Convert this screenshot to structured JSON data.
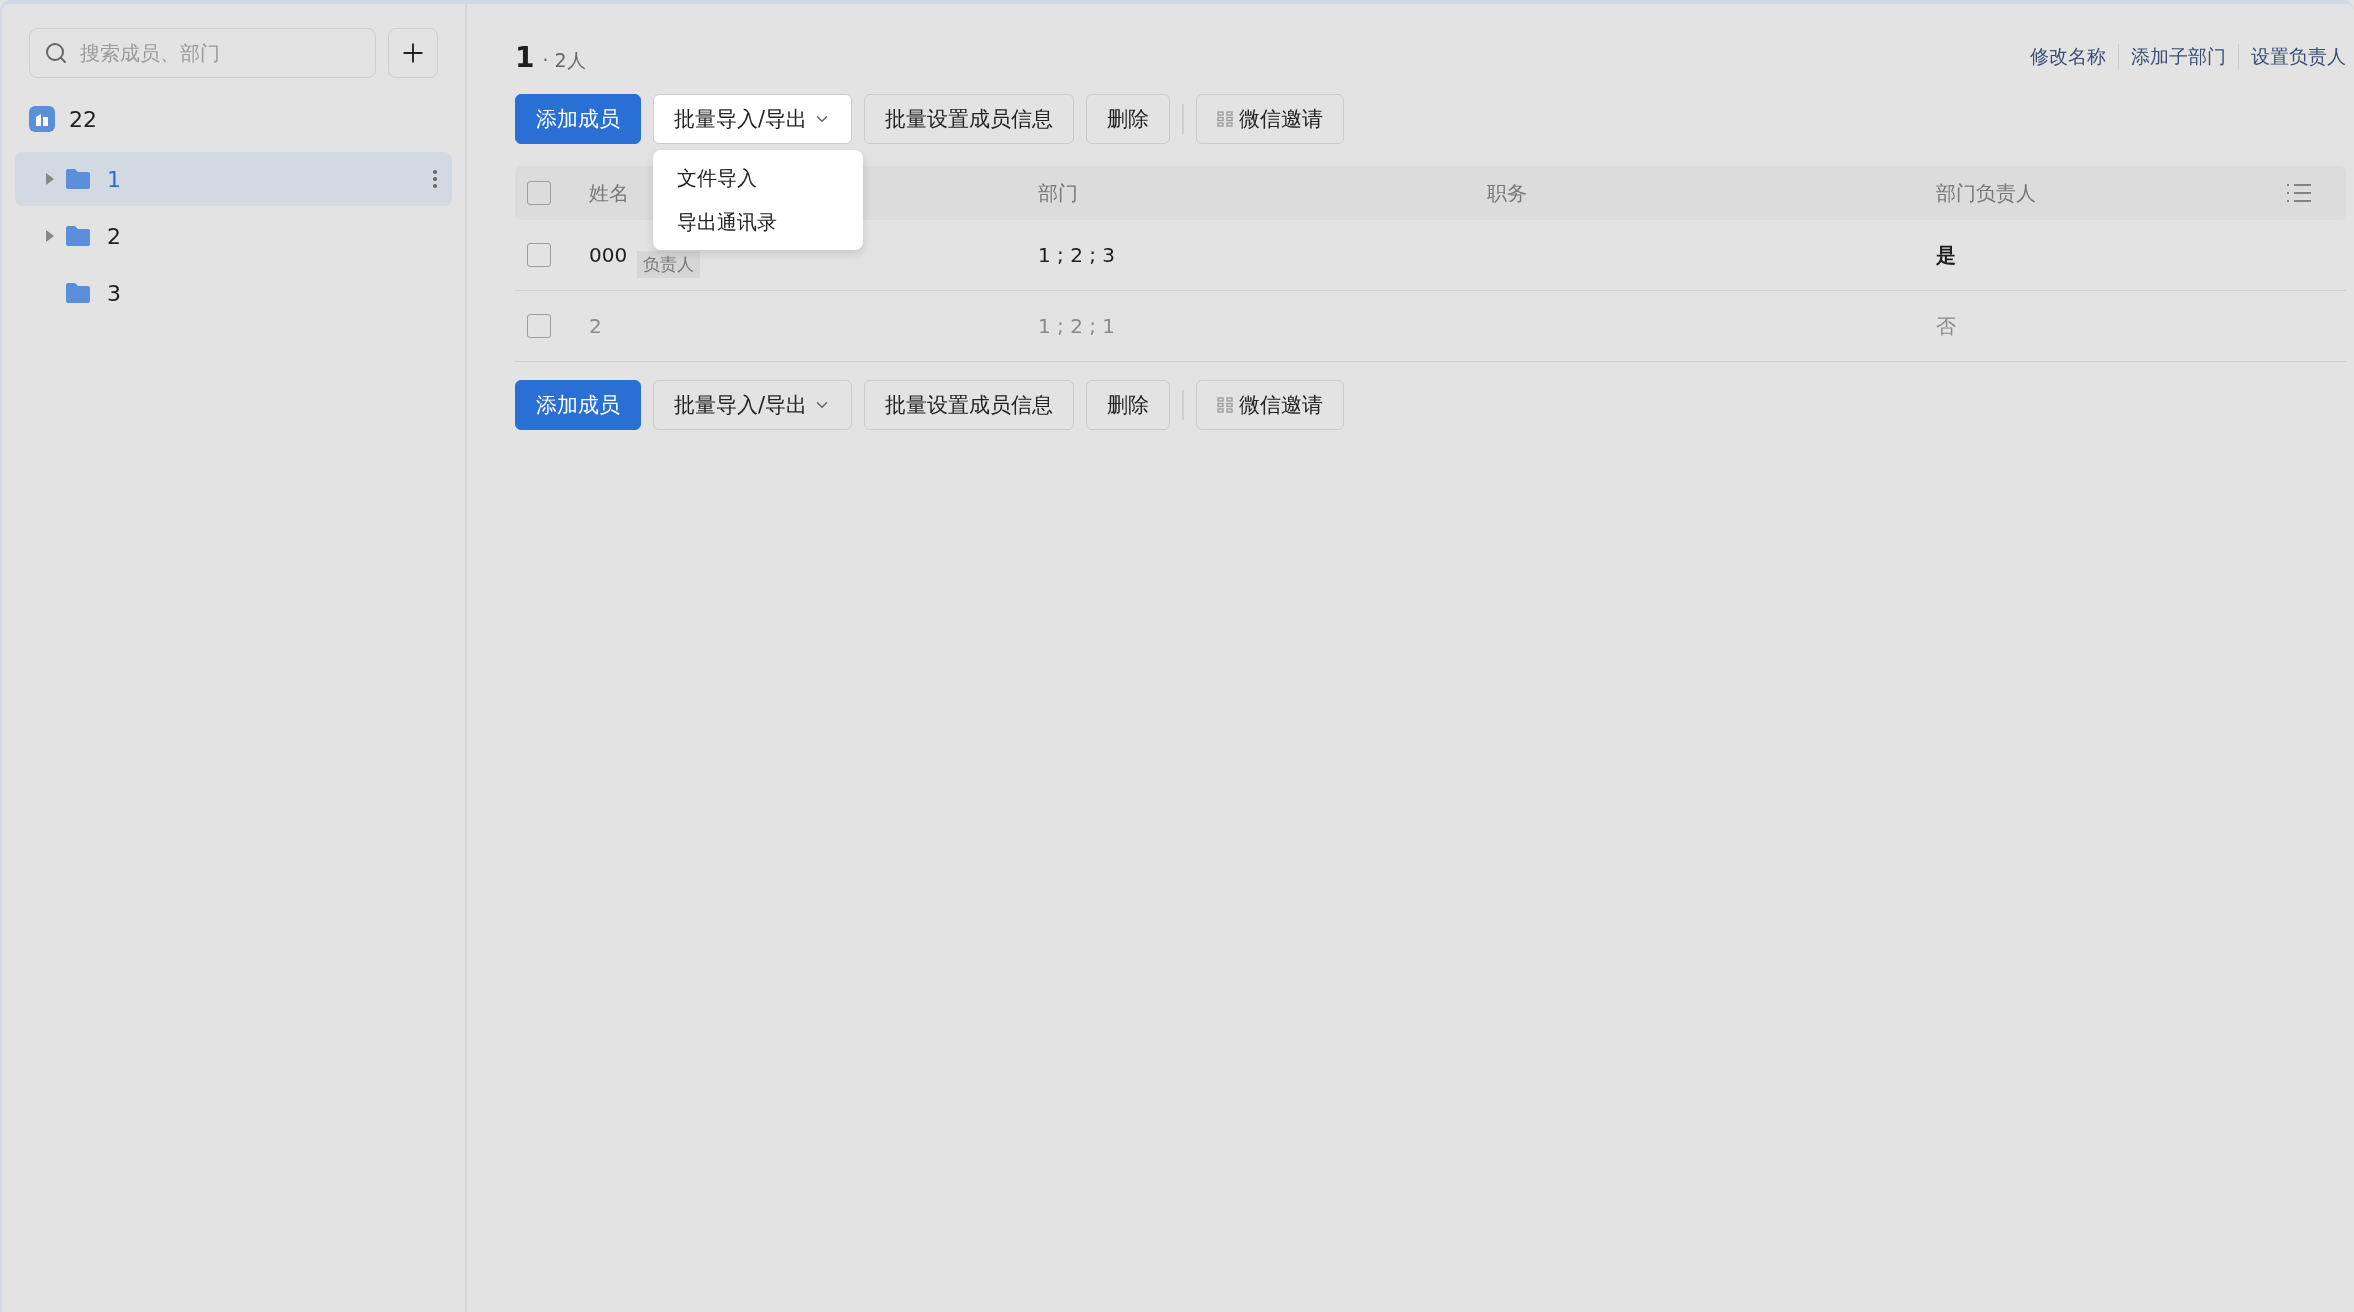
{
  "sidebar": {
    "search": {
      "placeholder": "搜索成员、部门"
    },
    "root": {
      "label": "22"
    },
    "tree": [
      {
        "label": "1",
        "selected": true,
        "expandable": true
      },
      {
        "label": "2",
        "selected": false,
        "expandable": true
      },
      {
        "label": "3",
        "selected": false,
        "expandable": false
      }
    ]
  },
  "header": {
    "title": "1",
    "count": "· 2人",
    "links": [
      "修改名称",
      "添加子部门",
      "设置负责人"
    ]
  },
  "toolbars": [
    {
      "buttons": [
        {
          "kind": "primary",
          "label": "添加成员"
        },
        {
          "kind": "dropdown",
          "label": "批量导入/导出",
          "open": true,
          "menu": [
            "文件导入",
            "导出通讯录"
          ]
        },
        {
          "kind": "default",
          "label": "批量设置成员信息"
        },
        {
          "kind": "default",
          "label": "删除"
        },
        {
          "kind": "icon",
          "label": "微信邀请"
        }
      ]
    },
    {
      "buttons": [
        {
          "kind": "primary",
          "label": "添加成员"
        },
        {
          "kind": "dropdown",
          "label": "批量导入/导出",
          "open": false
        },
        {
          "kind": "default",
          "label": "批量设置成员信息"
        },
        {
          "kind": "default",
          "label": "删除"
        },
        {
          "kind": "icon",
          "label": "微信邀请"
        }
      ]
    }
  ],
  "table": {
    "select_all": {
      "checked": false
    },
    "columns": [
      "姓名",
      "部门",
      "职务",
      "部门负责人"
    ],
    "rows": [
      {
        "checked": false,
        "disabled": false,
        "name": "000",
        "tag": "负责人",
        "department": "1 ; 2 ; 3",
        "head": "是"
      },
      {
        "checked": false,
        "disabled": true,
        "name": "2",
        "department": "1 ; 2 ; 1",
        "head": "否"
      }
    ]
  }
}
